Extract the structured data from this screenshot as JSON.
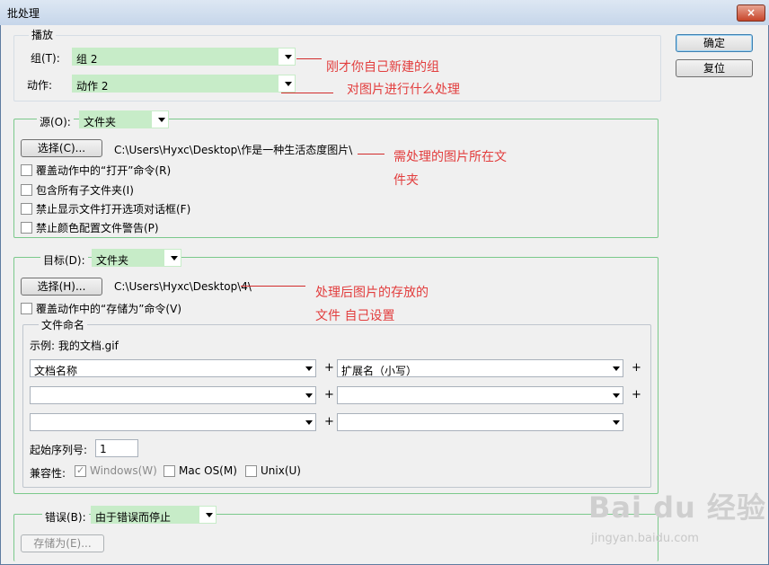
{
  "window": {
    "title": "批处理",
    "close_glyph": "×"
  },
  "buttons": {
    "ok": "确定",
    "reset": "复位"
  },
  "play": {
    "legend": "播放",
    "set_label": "组(T):",
    "set_value": "组 2",
    "action_label": "动作:",
    "action_value": "动作 2"
  },
  "source": {
    "label": "源(O):",
    "value": "文件夹",
    "choose_button": "选择(C)...",
    "path": "C:\\Users\\Hyxc\\Desktop\\作是一种生活态度图片\\",
    "options": [
      "覆盖动作中的“打开”命令(R)",
      "包含所有子文件夹(I)",
      "禁止显示文件打开选项对话框(F)",
      "禁止颜色配置文件警告(P)"
    ]
  },
  "destination": {
    "label": "目标(D):",
    "value": "文件夹",
    "choose_button": "选择(H)...",
    "path": "C:\\Users\\Hyxc\\Desktop\\4\\",
    "override_save": "覆盖动作中的“存储为”命令(V)"
  },
  "naming": {
    "legend": "文件命名",
    "example": "示例: 我的文档.gif",
    "fields": [
      "文档名称",
      "扩展名（小写）",
      "",
      "",
      "",
      ""
    ],
    "plus": "+",
    "serial_label": "起始序列号:",
    "serial_value": "1",
    "compat_label": "兼容性:",
    "compat": [
      "Windows(W)",
      "Mac OS(M)",
      "Unix(U)"
    ]
  },
  "errors": {
    "label": "错误(B):",
    "value": "由于错误而停止",
    "save_as": "存储为(E)..."
  },
  "annotations": {
    "set": "刚才你自己新建的组",
    "action": "对图片进行什么处理",
    "source_line1": "需处理的图片所在文",
    "source_line2": "件夹",
    "dest_line1": "处理后图片的存放的",
    "dest_line2": "文件 自己设置"
  },
  "watermark": {
    "logo": "Bai du 经验",
    "url": "jingyan.baidu.com"
  },
  "colors": {
    "highlight": "#c7ecc8",
    "annotation": "#e23d3d",
    "group_border": "#7bc98b"
  }
}
